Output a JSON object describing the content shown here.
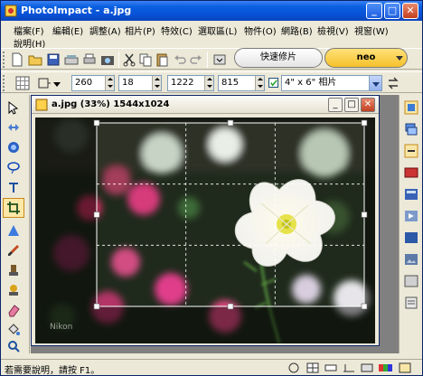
{
  "window": {
    "title": "PhotoImpact - a.jpg"
  },
  "menu": [
    {
      "label": "檔案(F)"
    },
    {
      "label": "編輯(E)"
    },
    {
      "label": "調整(A)"
    },
    {
      "label": "相片(P)"
    },
    {
      "label": "特效(C)"
    },
    {
      "label": "選取區(L)"
    },
    {
      "label": "物件(O)"
    },
    {
      "label": "網路(B)"
    },
    {
      "label": "檢視(V)"
    },
    {
      "label": "視窗(W)"
    },
    {
      "label": "說明(H)"
    }
  ],
  "quickbar": {
    "quick_fix_label": "快速修片",
    "neo_label": "neo"
  },
  "attributes": {
    "x": "260",
    "y": "18",
    "width": "1222",
    "height": "815",
    "preset": "4\" x 6\" 相片"
  },
  "document": {
    "title": "a.jpg (33%) 1544x1024",
    "watermark": "Nikon"
  },
  "status": {
    "message": "若需要說明，請按 F1。"
  },
  "colors": {
    "titlebar": "#0a5fe0",
    "neo_pill": "#f5c02a",
    "flower": "#ffffff",
    "flower_center": "#e6e24a"
  }
}
